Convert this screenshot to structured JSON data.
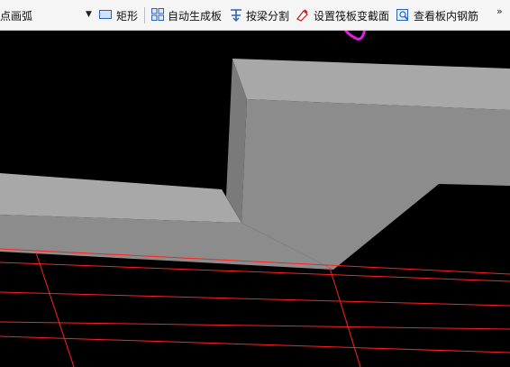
{
  "toolbar": {
    "arc_tool_label": "点画弧",
    "rect_label": "矩形",
    "auto_slab_label": "自动生成板",
    "split_by_beam_label": "按梁分割",
    "set_raft_slope_label": "设置筏板变截面",
    "view_slab_rebar_label": "查看板内钢筋",
    "overflow_label": "»"
  },
  "scene": {
    "background": "#000000",
    "grid_color": "#ff2020",
    "face_top_color": "#a8a8a8",
    "face_front_color": "#8c8c8c",
    "face_side_color": "#7a7a7a",
    "annotation_color": "#e020e0"
  }
}
